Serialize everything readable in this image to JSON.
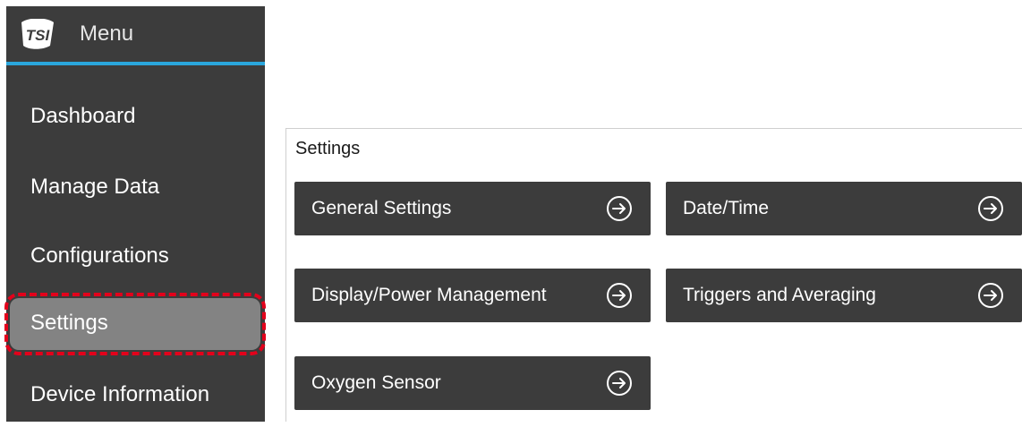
{
  "sidebar": {
    "title": "Menu",
    "logo_icon": "tsi-logo-icon",
    "accent_color": "#2aa6dc",
    "items": [
      {
        "label": "Dashboard"
      },
      {
        "label": "Manage Data"
      },
      {
        "label": "Configurations"
      },
      {
        "label": "Settings",
        "active": true
      },
      {
        "label": "Device Information"
      }
    ],
    "highlight_color": "#e3001b"
  },
  "main": {
    "panel_title": "Settings",
    "buttons": [
      {
        "label": "General Settings",
        "icon": "arrow-right-circle-icon"
      },
      {
        "label": "Date/Time",
        "icon": "arrow-right-circle-icon"
      },
      {
        "label": "Display/Power Management",
        "icon": "arrow-right-circle-icon"
      },
      {
        "label": "Triggers and Averaging",
        "icon": "arrow-right-circle-icon"
      },
      {
        "label": "Oxygen Sensor",
        "icon": "arrow-right-circle-icon"
      }
    ]
  }
}
